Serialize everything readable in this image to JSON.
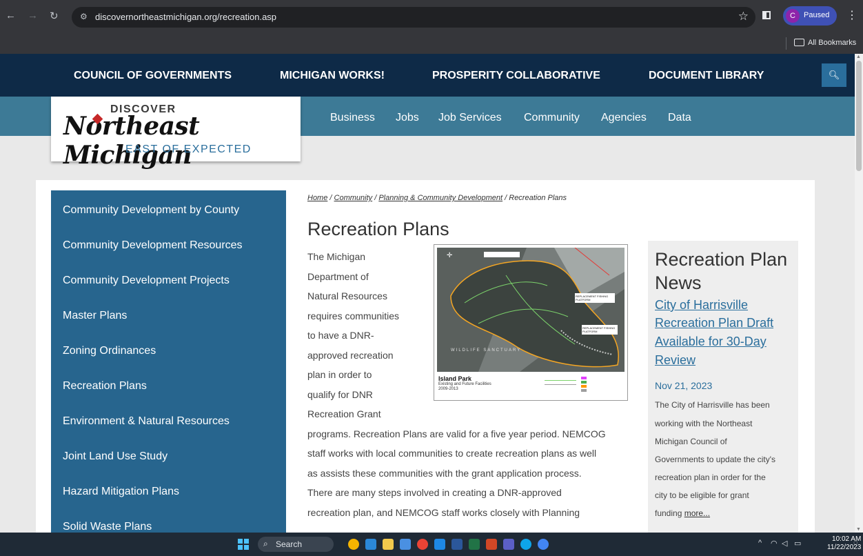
{
  "browser": {
    "url": "discovernortheastmichigan.org/recreation.asp",
    "profile_initial": "C",
    "profile_status": "Paused",
    "bookmarks_label": "All Bookmarks"
  },
  "top_nav": [
    "COUNCIL OF GOVERNMENTS",
    "MICHIGAN WORKS!",
    "PROSPERITY COLLABORATIVE",
    "DOCUMENT LIBRARY"
  ],
  "sub_nav": [
    "Business",
    "Jobs",
    "Job Services",
    "Community",
    "Agencies",
    "Data"
  ],
  "logo": {
    "line1": "DISCOVER",
    "line2": "Northeast Michigan",
    "line3": "EAST OF EXPECTED"
  },
  "sidebar": [
    "Community Development by County",
    "Community Development Resources",
    "Community Development Projects",
    "Master Plans",
    "Zoning Ordinances",
    "Recreation Plans",
    "Environment & Natural Resources",
    "Joint Land Use Study",
    "Hazard Mitigation Plans",
    "Solid Waste Plans"
  ],
  "breadcrumb": {
    "home": "Home",
    "community": "Community",
    "planning": "Planning & Community Development",
    "current": "Recreation Plans",
    "sep": " / "
  },
  "page_title": "Recreation Plans",
  "body_lines": [
    "The Michigan",
    "Department of",
    "Natural Resources",
    "requires communities",
    "to have a DNR-",
    "approved recreation",
    "plan in order to",
    "qualify for DNR",
    "Recreation Grant",
    "programs. Recreation Plans are valid for a five year period. NEMCOG",
    "staff works with local communities to create recreation plans as well",
    "as assists these communities with the grant application process.",
    "There are many steps involved in creating a DNR-approved",
    "recreation plan, and NEMCOG staff works closely with Planning"
  ],
  "map": {
    "title": "Island Park",
    "subtitle": "Existing and Future Facilities",
    "years": "2009-2013",
    "labels": [
      "WILDLIFE SANCTUARY",
      "REPLACEMENT FISHING PLATFORM",
      "REPLACEMENT FISHING PLATFORM"
    ],
    "legend_colors": [
      "#e040fb",
      "#4caf50",
      "#ff9800",
      "#9e9e9e"
    ]
  },
  "news": {
    "heading_line1": "Recreation Plan",
    "heading_line2": "News",
    "link_lines": [
      "City of Harrisville",
      "Recreation Plan Draft",
      "Available for 30-Day",
      "Review"
    ],
    "date": "Nov 21, 2023",
    "text_lines": [
      "The City of Harrisville has been",
      "working with the Northeast",
      "Michigan Council of",
      "Governments to update the city's",
      "recreation plan in order for the",
      "city to be eligible for grant",
      "funding"
    ],
    "more": "more..."
  },
  "taskbar": {
    "search": "Search",
    "time": "10:02 AM",
    "date": "11/22/2023",
    "app_colors": [
      "#f5b400",
      "#2b88d8",
      "#f2c94c",
      "#4a90e2",
      "#ea4335",
      "#1e88e5",
      "#2b579a",
      "#217346",
      "#d24726",
      "#5b5fc7",
      "#0ea5e9",
      "#4285f4"
    ]
  },
  "colors": {
    "top_nav": "#0e2a47",
    "sub_nav": "#3d7a96",
    "sidebar": "#27658e",
    "link": "#2a6e9c"
  }
}
